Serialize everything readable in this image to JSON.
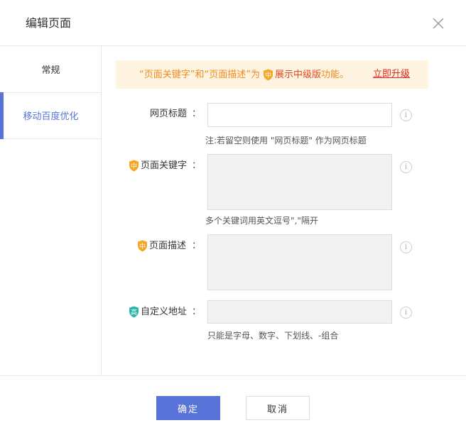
{
  "dialog": {
    "title": "编辑页面"
  },
  "sidebar": {
    "items": [
      {
        "label": "常规"
      },
      {
        "label": "移动百度优化"
      }
    ]
  },
  "notice": {
    "text_prefix": "“页面关键字”和“页面描述”为",
    "badge_text": "中",
    "highlight": "展示中级版",
    "suffix": "功能。",
    "upgrade_link": "立即升级"
  },
  "form": {
    "page_title": {
      "label": "网页标题",
      "colon": "：",
      "value": "",
      "hint": "注:若留空则使用 \"网页标题\" 作为网页标题"
    },
    "page_keywords": {
      "badge": "中",
      "label": "页面关键字",
      "colon": "：",
      "value": "",
      "hint": "多个关键词用英文逗号\",\"隔开"
    },
    "page_description": {
      "badge": "中",
      "label": "页面描述",
      "colon": "：",
      "value": ""
    },
    "custom_url": {
      "badge": "高",
      "label": "自定义地址",
      "colon": "：",
      "value": "",
      "hint": "只能是字母、数字、下划线、-组合"
    },
    "info_glyph": "i"
  },
  "footer": {
    "ok_label": "确定",
    "cancel_label": "取消"
  },
  "colors": {
    "accent": "#5874d8",
    "badge_mid": "#f5a623",
    "badge_high": "#2bb5a8",
    "notice_bg": "#fff4e0",
    "upgrade": "#e0261e"
  }
}
